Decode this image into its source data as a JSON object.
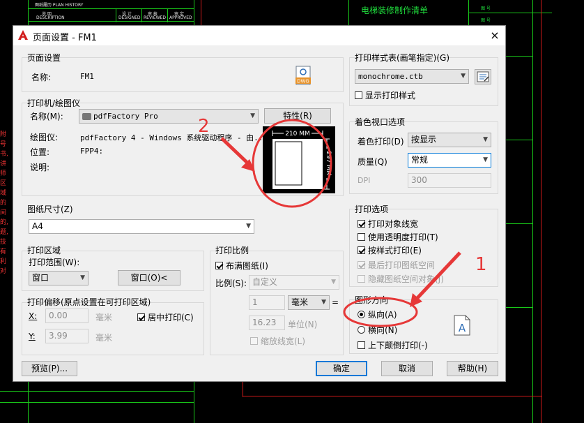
{
  "background": {
    "header_left_1": "图纸履历 PLAN HISTORY",
    "header_left_2": "说 明",
    "header_left_3": "DESCRIPTION",
    "col1": "设 计",
    "col1_en": "DESIGNED",
    "col2": "审 核",
    "col2_en": "REVIEWED",
    "col3": "审 定",
    "col3_en": "APPROVED",
    "right_title": "电梯装修制作清单",
    "right_label_1": "图 号",
    "right_label_2": "图 号",
    "red_note": "附号 书, 讲师 区域 的间 的, 题, 技有 利对"
  },
  "dialog": {
    "title": "页面设置 - FM1",
    "close_symbol": "×",
    "page_setup": {
      "group_label": "页面设置",
      "name_label": "名称:",
      "name_value": "FM1",
      "dwg_icon_text": "DWG"
    },
    "printer": {
      "group_label": "打印机/绘图仪",
      "name_label": "名称(M):",
      "name_value": "pdfFactory Pro",
      "properties_button": "特性(R)",
      "plotter_label": "绘图仪:",
      "plotter_value": "pdfFactory 4 - Windows 系统驱动程序 - 由...",
      "location_label": "位置:",
      "location_value": "FPP4:",
      "description_label": "说明:"
    },
    "preview": {
      "width_text": "210 MM",
      "height_text": "297 MM"
    },
    "paper_size": {
      "group_label": "图纸尺寸(Z)",
      "value": "A4"
    },
    "plot_area": {
      "group_label": "打印区域",
      "range_label": "打印范围(W):",
      "range_value": "窗口",
      "window_button": "窗口(O)<"
    },
    "plot_offset": {
      "group_label": "打印偏移(原点设置在可打印区域)",
      "x_label": "X:",
      "x_value": "0.00",
      "x_unit": "毫米",
      "y_label": "Y:",
      "y_value": "3.99",
      "y_unit": "毫米",
      "center_label": "居中打印(C)"
    },
    "plot_scale": {
      "group_label": "打印比例",
      "fit_label": "布满图纸(I)",
      "scale_label": "比例(S):",
      "scale_value": "自定义",
      "value1": "1",
      "unit1": "毫米",
      "equals": "=",
      "value2": "16.23",
      "unit2": "单位(N)",
      "scale_lineweights_label": "缩放线宽(L)"
    },
    "plot_style_table": {
      "group_label": "打印样式表(画笔指定)(G)",
      "value": "monochrome.ctb",
      "show_styles_label": "显示打印样式"
    },
    "shaded_viewport": {
      "group_label": "着色视口选项",
      "shade_label": "着色打印(D)",
      "shade_value": "按显示",
      "quality_label": "质量(Q)",
      "quality_value": "常规",
      "dpi_label": "DPI",
      "dpi_value": "300"
    },
    "plot_options": {
      "group_label": "打印选项",
      "opt1": "打印对象线宽",
      "opt2": "使用透明度打印(T)",
      "opt3": "按样式打印(E)",
      "opt4": "最后打印图纸空间",
      "opt5": "隐藏图纸空间对象(J)"
    },
    "orientation": {
      "group_label": "图形方向",
      "portrait_label": "纵向(A)",
      "landscape_label": "横向(N)",
      "upside_down_label": "上下颠倒打印(-)",
      "icon_letter": "A"
    },
    "buttons": {
      "preview": "预览(P)...",
      "ok": "确定",
      "cancel": "取消",
      "help": "帮助(H)"
    }
  },
  "annotations": {
    "label_1": "1",
    "label_2": "2"
  },
  "colors": {
    "cad_green": "#19c919",
    "annotation_red": "#e63838",
    "accent_blue": "#0078d7"
  }
}
